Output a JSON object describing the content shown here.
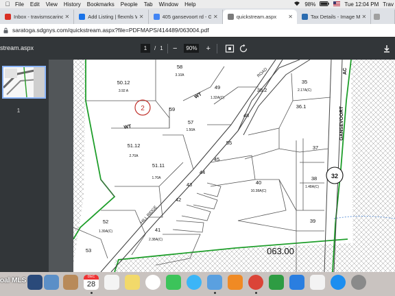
{
  "menubar": {
    "items": [
      "File",
      "Edit",
      "View",
      "History",
      "Bookmarks",
      "People",
      "Tab",
      "Window",
      "Help"
    ],
    "battery": "98%",
    "clock": "Tue 12:04 PM",
    "user": "Trav"
  },
  "tabs": [
    {
      "label": "Inbox - travismscarincio@",
      "favicon_color": "#d93025",
      "active": false
    },
    {
      "label": "Add Listing | flexmls Web",
      "favicon_color": "#1a73e8",
      "active": false
    },
    {
      "label": "405 gansevoort rd - Googl",
      "favicon_color": "#4285f4",
      "active": false
    },
    {
      "label": "quickstream.aspx",
      "favicon_color": "#7b7b7b",
      "active": true
    },
    {
      "label": "Tax Details - Image Mate C",
      "favicon_color": "#2b6cb0",
      "active": false
    },
    {
      "label": "",
      "favicon_color": "#a0a0a0",
      "active": false
    }
  ],
  "address": {
    "url": "saratoga.sdgnys.com/quickstream.aspx?file=PDFMAPS/414489/063004.pdf"
  },
  "pdf_toolbar": {
    "title": "stream.aspx",
    "page_current": "1",
    "page_separator": "/",
    "page_total": "1",
    "zoom_minus": "−",
    "zoom": "90%",
    "zoom_plus": "+"
  },
  "sidebar": {
    "page_number": "1"
  },
  "map": {
    "parcels": [
      {
        "id": "58",
        "acreage": "3.10A"
      },
      {
        "id": "50.12",
        "acreage": "3.92 A"
      },
      {
        "id": "49",
        "acreage": "1.32A(C)"
      },
      {
        "id": "38.2",
        "acreage": ""
      },
      {
        "id": "35",
        "acreage": "2.17A(C)"
      },
      {
        "id": "36.1",
        "acreage": ""
      },
      {
        "id": "59",
        "acreage": ""
      },
      {
        "id": "57",
        "acreage": "1.50A"
      },
      {
        "id": "48",
        "acreage": ""
      },
      {
        "id": "55",
        "acreage": ""
      },
      {
        "id": "51.12",
        "acreage": "2.70A"
      },
      {
        "id": "45",
        "acreage": ""
      },
      {
        "id": "44",
        "acreage": ""
      },
      {
        "id": "51.11",
        "acreage": "1.70A"
      },
      {
        "id": "43",
        "acreage": ""
      },
      {
        "id": "40",
        "acreage": "10.38A(C)"
      },
      {
        "id": "42",
        "acreage": ""
      },
      {
        "id": "37",
        "acreage": ""
      },
      {
        "id": "38",
        "acreage": "1.48A(C)"
      },
      {
        "id": "52",
        "acreage": "1.39A(C)"
      },
      {
        "id": "41",
        "acreage": "2.38A(C)"
      },
      {
        "id": "39",
        "acreage": ""
      },
      {
        "id": "53",
        "acreage": ""
      }
    ],
    "circled_number": "2",
    "route_marker": "32",
    "road_labels": [
      "ROAD",
      "GANSEVOORT",
      "HILL RIDGE",
      "AC"
    ],
    "wt_labels": [
      "WT",
      "WT"
    ],
    "section_number": "063.00"
  },
  "dock": {
    "label": "oal MLS",
    "calendar_month": "DEC",
    "calendar_day": "28",
    "icons": [
      {
        "name": "mls-app-icon",
        "color": "#2a4a7a"
      },
      {
        "name": "preview-icon",
        "color": "#5b8fc7"
      },
      {
        "name": "contacts-icon",
        "color": "#b88a5a"
      },
      {
        "name": "calendar-icon",
        "color": "#ffffff"
      },
      {
        "name": "notes-icon",
        "color": "#f4f4f4"
      },
      {
        "name": "reminders-icon",
        "color": "#f2d96a"
      },
      {
        "name": "photos-icon",
        "color": "#ffffff"
      },
      {
        "name": "facetime-icon",
        "color": "#3cc45a"
      },
      {
        "name": "messages-icon",
        "color": "#3bb5f7"
      },
      {
        "name": "preview-app-icon",
        "color": "#5aa0e0"
      },
      {
        "name": "books-icon",
        "color": "#f08a24"
      },
      {
        "name": "chrome-icon",
        "color": "#db4437"
      },
      {
        "name": "numbers-icon",
        "color": "#2e9c43"
      },
      {
        "name": "keynote-icon",
        "color": "#2a7ee0"
      },
      {
        "name": "music-icon",
        "color": "#f3f3f3"
      },
      {
        "name": "app-store-icon",
        "color": "#1c8ef0"
      },
      {
        "name": "system-preferences-icon",
        "color": "#8a8a8a"
      }
    ]
  }
}
